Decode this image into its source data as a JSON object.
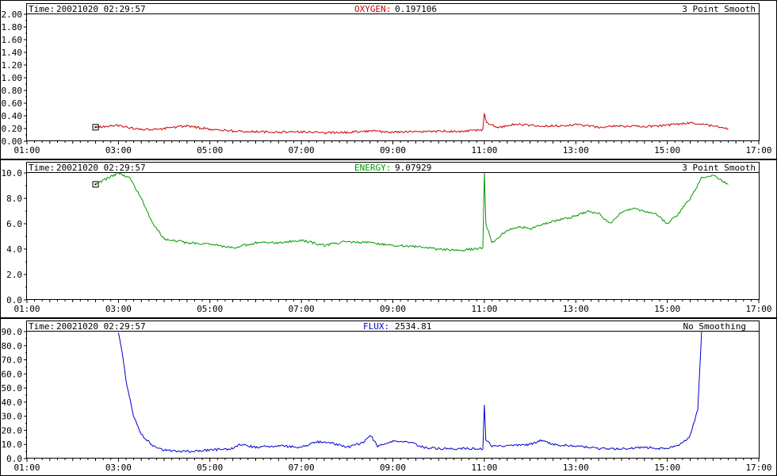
{
  "panels": [
    {
      "header": {
        "time_label": "Time:",
        "time_value": "20021020 02:29:57",
        "var_name": "OXYGEN:",
        "var_value": "0.197106",
        "smoothing": "3 Point Smooth"
      },
      "color": "#cc0000"
    },
    {
      "header": {
        "time_label": "Time:",
        "time_value": "20021020 02:29:57",
        "var_name": "ENERGY:",
        "var_value": "9.07929",
        "smoothing": "3 Point Smooth"
      },
      "color": "#009900"
    },
    {
      "header": {
        "time_label": "Time:",
        "time_value": "20021020 02:29:57",
        "var_name": "FLUX:",
        "var_value": "2534.81",
        "smoothing": "No Smoothing"
      },
      "color": "#0000cc"
    }
  ],
  "chart_data": [
    {
      "type": "line",
      "title": "OXYGEN",
      "ylim": [
        0,
        2.0
      ],
      "yticks": [
        "0.00",
        "0.20",
        "0.40",
        "0.60",
        "0.80",
        "1.00",
        "1.20",
        "1.40",
        "1.60",
        "1.80",
        "2.00"
      ],
      "xlim": [
        "01:00",
        "17:00"
      ],
      "xticks": [
        "01:00",
        "03:00",
        "05:00",
        "07:00",
        "09:00",
        "11:00",
        "13:00",
        "15:00",
        "17:00"
      ],
      "series": [
        {
          "color": "#cc0000",
          "x": [
            "02:30",
            "03:00",
            "03:30",
            "04:00",
            "04:30",
            "05:00",
            "05:30",
            "06:00",
            "06:30",
            "07:00",
            "07:30",
            "08:00",
            "08:30",
            "09:00",
            "09:30",
            "10:00",
            "10:30",
            "10:58",
            "11:00",
            "11:03",
            "11:10",
            "11:20",
            "11:40",
            "12:00",
            "12:30",
            "13:00",
            "13:30",
            "14:00",
            "14:30",
            "15:00",
            "15:30",
            "16:00",
            "16:20"
          ],
          "values": [
            0.22,
            0.25,
            0.18,
            0.2,
            0.24,
            0.19,
            0.16,
            0.15,
            0.14,
            0.15,
            0.13,
            0.14,
            0.16,
            0.14,
            0.15,
            0.16,
            0.15,
            0.18,
            0.43,
            0.3,
            0.25,
            0.22,
            0.27,
            0.25,
            0.24,
            0.26,
            0.22,
            0.24,
            0.23,
            0.25,
            0.29,
            0.24,
            0.2
          ]
        }
      ]
    },
    {
      "type": "line",
      "title": "ENERGY",
      "ylim": [
        0,
        10.0
      ],
      "yticks": [
        "0.0",
        "2.0",
        "4.0",
        "6.0",
        "8.0",
        "10.0"
      ],
      "xlim": [
        "01:00",
        "17:00"
      ],
      "xticks": [
        "01:00",
        "03:00",
        "05:00",
        "07:00",
        "09:00",
        "11:00",
        "13:00",
        "15:00",
        "17:00"
      ],
      "series": [
        {
          "color": "#009900",
          "x": [
            "02:30",
            "02:50",
            "03:00",
            "03:15",
            "03:30",
            "03:45",
            "04:00",
            "04:30",
            "05:00",
            "05:30",
            "06:00",
            "06:30",
            "07:00",
            "07:30",
            "08:00",
            "08:30",
            "09:00",
            "09:30",
            "10:00",
            "10:30",
            "10:58",
            "11:00",
            "11:02",
            "11:10",
            "11:30",
            "11:45",
            "12:00",
            "12:30",
            "13:00",
            "13:15",
            "13:30",
            "13:45",
            "14:00",
            "14:15",
            "14:30",
            "14:45",
            "15:00",
            "15:15",
            "15:30",
            "15:45",
            "16:00",
            "16:20"
          ],
          "values": [
            9.1,
            9.7,
            10.0,
            9.6,
            8.0,
            6.0,
            4.8,
            4.5,
            4.4,
            4.1,
            4.5,
            4.5,
            4.7,
            4.3,
            4.6,
            4.5,
            4.3,
            4.2,
            4.0,
            3.9,
            4.1,
            10.0,
            6.0,
            4.5,
            5.5,
            5.8,
            5.6,
            6.2,
            6.6,
            7.0,
            6.8,
            6.0,
            6.9,
            7.2,
            7.0,
            6.8,
            6.0,
            6.8,
            8.0,
            9.6,
            9.8,
            9.1
          ]
        }
      ]
    },
    {
      "type": "line",
      "title": "FLUX",
      "ylim": [
        0,
        90.0
      ],
      "yticks": [
        "0.0",
        "10.0",
        "20.0",
        "30.0",
        "40.0",
        "50.0",
        "60.0",
        "70.0",
        "80.0",
        "90.0"
      ],
      "xlim": [
        "01:00",
        "17:00"
      ],
      "xticks": [
        "01:00",
        "03:00",
        "05:00",
        "07:00",
        "09:00",
        "11:00",
        "13:00",
        "15:00",
        "17:00"
      ],
      "series": [
        {
          "color": "#0000cc",
          "x": [
            "03:00",
            "03:05",
            "03:10",
            "03:20",
            "03:30",
            "03:45",
            "04:00",
            "04:30",
            "05:00",
            "05:30",
            "05:40",
            "06:00",
            "06:30",
            "07:00",
            "07:20",
            "07:40",
            "08:00",
            "08:20",
            "08:30",
            "08:40",
            "09:00",
            "09:20",
            "09:40",
            "10:00",
            "10:30",
            "10:58",
            "11:00",
            "11:02",
            "11:10",
            "11:30",
            "12:00",
            "12:15",
            "12:30",
            "13:00",
            "13:30",
            "14:00",
            "14:30",
            "15:00",
            "15:15",
            "15:30",
            "15:40",
            "15:45"
          ],
          "values": [
            90,
            75,
            55,
            30,
            17,
            9,
            6,
            5,
            6,
            7,
            10,
            8,
            9,
            8,
            12,
            11,
            8,
            11,
            17,
            9,
            12,
            12,
            8,
            7,
            7,
            7,
            38,
            13,
            9,
            9,
            10,
            13,
            10,
            9,
            7,
            7,
            8,
            7,
            9,
            16,
            35,
            90
          ]
        }
      ]
    }
  ]
}
